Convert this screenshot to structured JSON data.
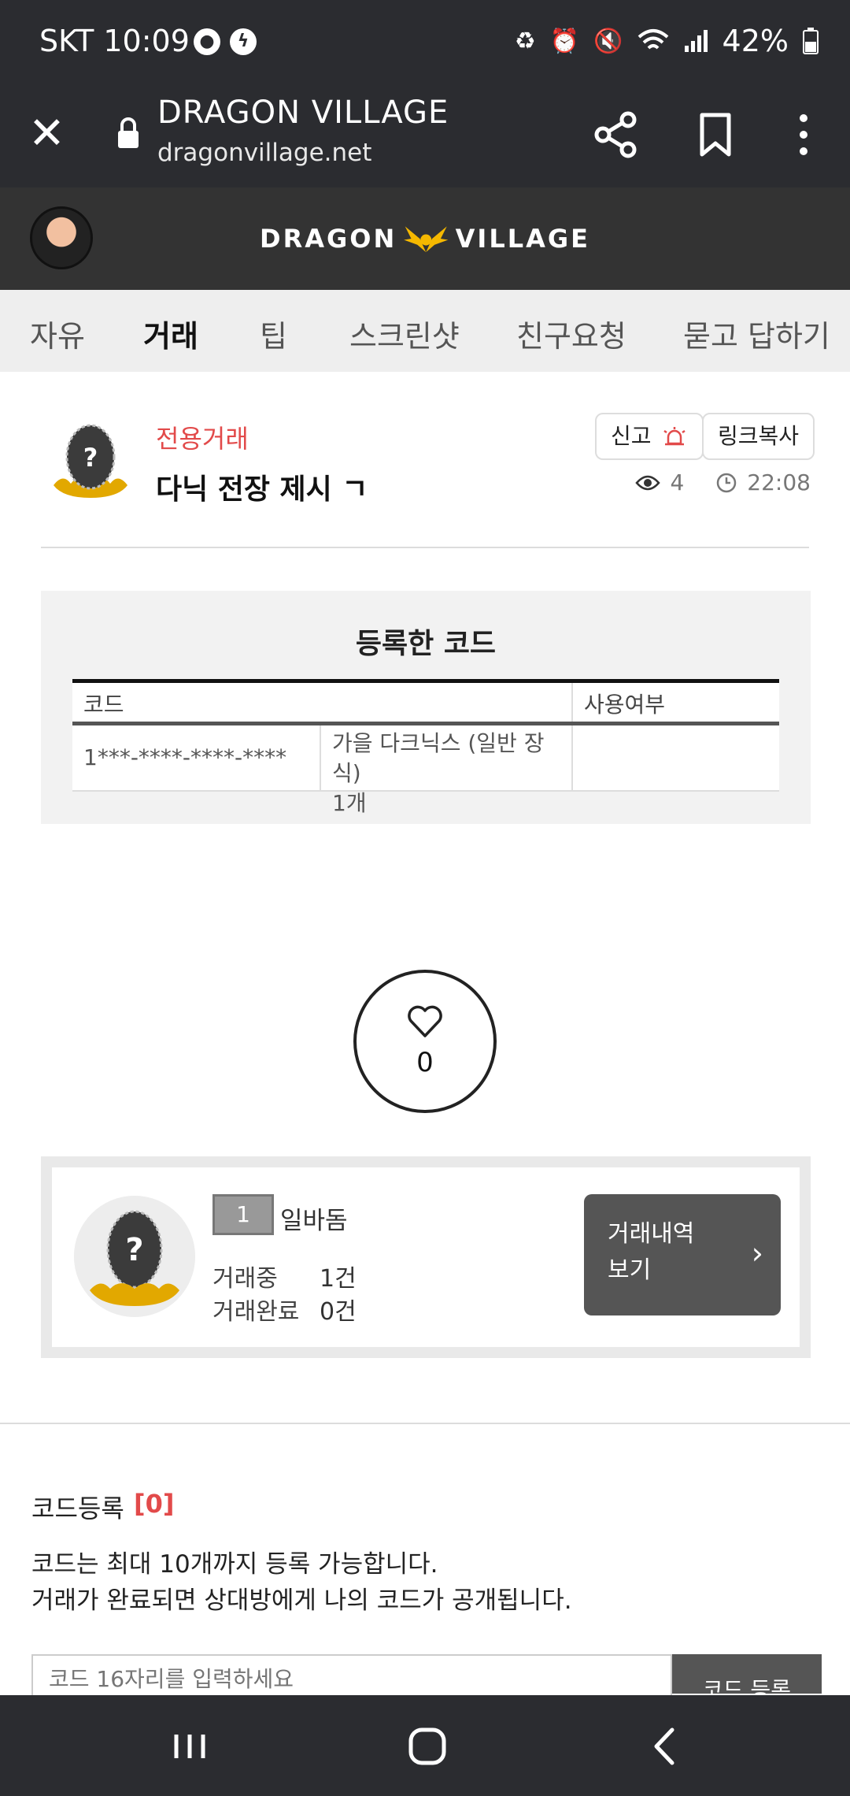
{
  "status_bar": {
    "carrier_time": "SKT 10:09",
    "battery": "42%",
    "icons": [
      "account-icon",
      "power-icon",
      "battery-saver-icon",
      "alarm-icon",
      "mute-icon",
      "wifi-icon",
      "signal-icon",
      "battery-icon"
    ]
  },
  "browser": {
    "title": "DRAGON VILLAGE",
    "url": "dragonvillage.net"
  },
  "site": {
    "logo_left": "DRAGON",
    "logo_right": "VILLAGE"
  },
  "tabs": [
    {
      "label": "자유"
    },
    {
      "label": "거래"
    },
    {
      "label": "팁"
    },
    {
      "label": "스크린샷"
    },
    {
      "label": "친구요청"
    },
    {
      "label": "묻고 답하기"
    }
  ],
  "post": {
    "category": "전용거래",
    "title": "다닉 전장 제시 ㄱ",
    "report_label": "신고",
    "copy_link_label": "링크복사",
    "views": "4",
    "time": "22:08"
  },
  "code_box": {
    "title": "등록한 코드",
    "col_code": "코드",
    "col_used": "사용여부",
    "rows": [
      {
        "code": "1***-****-****-****",
        "item": "가을 다크닉스 (일반 장식)",
        "qty": "1개",
        "used": ""
      }
    ]
  },
  "like": {
    "count": "0"
  },
  "user": {
    "level": "1",
    "name": "일바돔",
    "trading_label": "거래중",
    "trading_value": "1건",
    "done_label": "거래완료",
    "done_value": "0건",
    "history_line1": "거래내역",
    "history_line2": "보기"
  },
  "register": {
    "title": "코드등록",
    "count": "[0]",
    "desc1": "코드는 최대 10개까지 등록 가능합니다.",
    "desc2": "거래가 완료되면 상대방에게 나의 코드가 공개됩니다.",
    "input_placeholder": "코드 16자리를 입력하세요",
    "submit_label": "코드 등록"
  },
  "colors": {
    "dark_bar": "#2b2c30",
    "header": "#333333",
    "accent_red": "#e24a4a",
    "tab_underline": "#f5c400"
  }
}
